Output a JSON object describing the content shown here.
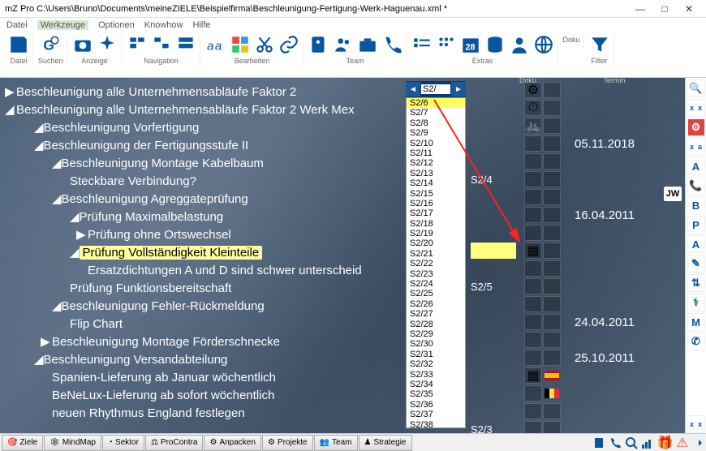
{
  "title": "mZ Pro C:\\Users\\Bruno\\Documents\\meineZIELE\\Beispielfirma\\Beschleunigung-Fertigung-Werk-Haguenau.xml *",
  "menu": [
    "Datei",
    "Werkzeuge",
    "Optionen",
    "Knowhow",
    "Hilfe"
  ],
  "toolbar": {
    "g1": "Datei",
    "g2": "Suchen",
    "g3": "Anzeige",
    "g4": "Navigation",
    "g5": "Bearbeiten",
    "g6": "Team",
    "g7": "Extras",
    "g8": "Doku",
    "g9": "Filter"
  },
  "columns": {
    "doku": "Doku",
    "termin": "Termin"
  },
  "tree": [
    {
      "i": 0,
      "a": "▶",
      "t": "Beschleunigung alle Unternehmensabläufe Faktor 2"
    },
    {
      "i": 0,
      "a": "◢",
      "t": "Beschleunigung alle Unternehmensabläufe Faktor 2 Werk Mex"
    },
    {
      "i": 1,
      "a": "",
      "b": "◢",
      "t": "Beschleunigung Vorfertigung"
    },
    {
      "i": 1,
      "a": "",
      "b": "◢",
      "t": "Beschleunigung der Fertigungsstufe II"
    },
    {
      "i": 2,
      "a": "",
      "b": "◢",
      "t": "Beschleunigung Montage Kabelbaum"
    },
    {
      "i": 3,
      "a": "",
      "t": "Steckbare Verbindung?"
    },
    {
      "i": 2,
      "a": "",
      "b": "◢",
      "t": "Beschleunigung Agreggateprüfung"
    },
    {
      "i": 3,
      "a": "",
      "b": "◢",
      "t": "Prüfung Maximalbelastung"
    },
    {
      "i": 4,
      "a": "▶",
      "t": "Prüfung ohne Ortswechsel"
    },
    {
      "i": 3,
      "a": "",
      "b": "◢",
      "t": "Prüfung Vollständigkeit Kleinteile",
      "hl": true
    },
    {
      "i": 4,
      "a": "",
      "t": "Ersatzdichtungen A und D sind schwer unterscheid"
    },
    {
      "i": 3,
      "a": "",
      "t": "Prüfung Funktionsbereitschaft"
    },
    {
      "i": 2,
      "a": "",
      "b": "◢",
      "t": "Beschleunigung Fehler-Rückmeldung"
    },
    {
      "i": 3,
      "a": "",
      "t": "Flip Chart"
    },
    {
      "i": 2,
      "a": "▶",
      "t": "Beschleunigung Montage Förderschnecke"
    },
    {
      "i": 1,
      "a": "",
      "b": "◢",
      "t": "Beschleunigung Versandabteilung"
    },
    {
      "i": 2,
      "a": "",
      "t": "Spanien-Lieferung ab Januar wöchentlich"
    },
    {
      "i": 2,
      "a": "",
      "t": "BeNeLux-Lieferung ab sofort wöchentlich"
    },
    {
      "i": 2,
      "a": "",
      "t": "neuen Rhythmus England festlegen"
    }
  ],
  "dd": {
    "search": "S2/",
    "items": [
      "S2/6",
      "S2/7",
      "S2/8",
      "S2/9",
      "S2/10",
      "S2/11",
      "S2/12",
      "S2/13",
      "S2/14",
      "S2/15",
      "S2/16",
      "S2/17",
      "S2/18",
      "S2/19",
      "S2/20",
      "S2/21",
      "S2/22",
      "S2/23",
      "S2/24",
      "S2/25",
      "S2/26",
      "S2/27",
      "S2/28",
      "S2/29",
      "S2/30",
      "S2/31",
      "S2/32",
      "S2/33",
      "S2/34",
      "S2/35",
      "S2/36",
      "S2/37",
      "S2/38"
    ],
    "selected": 0
  },
  "mid": {
    "5": "S2/4",
    "11": "S2/5",
    "19": "S2/3"
  },
  "dates": {
    "3": "05.11.2018",
    "7": "16.04.2011",
    "13": "24.04.2011",
    "15": "25.10.2011"
  },
  "jw": "JW",
  "rside": [
    "A",
    "B",
    "P",
    "A",
    "M"
  ],
  "footer": {
    "buttons": [
      "Ziele",
      "MindMap",
      "Sektor",
      "ProContra",
      "Anpacken",
      "Projekte",
      "Team",
      "Strategie"
    ]
  }
}
